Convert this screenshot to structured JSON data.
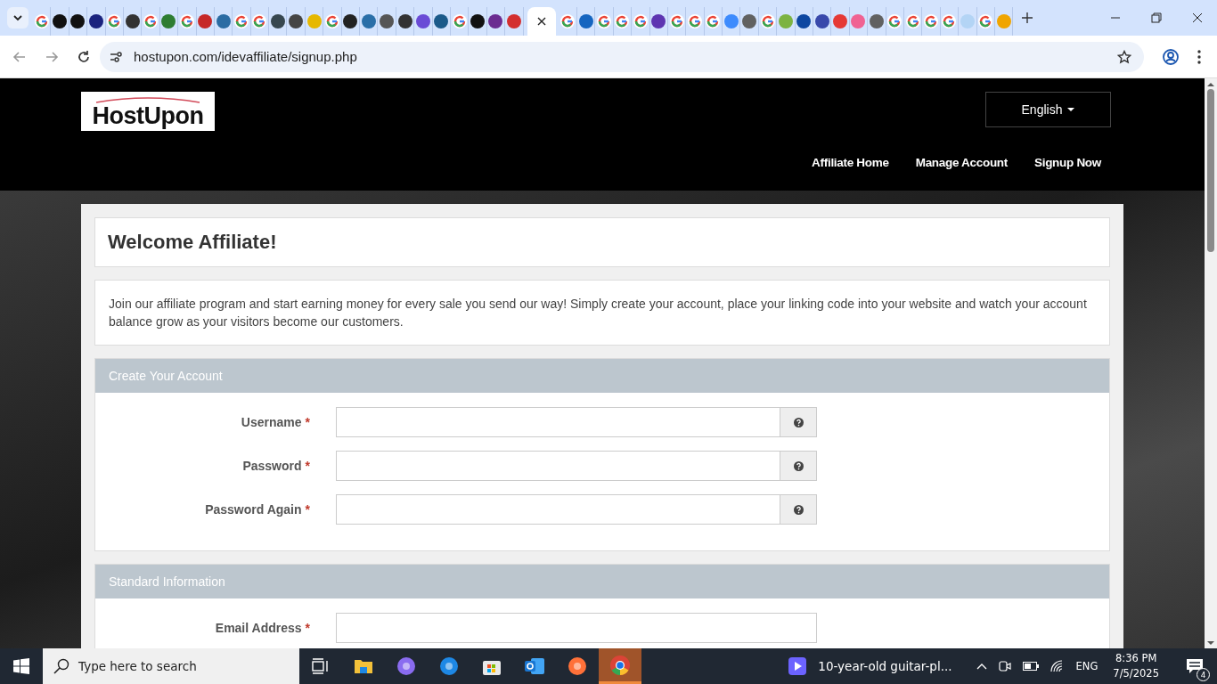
{
  "browser": {
    "tabs": [
      {
        "kind": "google",
        "selected": false
      },
      {
        "kind": "site",
        "color": "#111111",
        "selected": false
      },
      {
        "kind": "site",
        "color": "#111111",
        "selected": false
      },
      {
        "kind": "site",
        "color": "#1a237e",
        "selected": false
      },
      {
        "kind": "google",
        "selected": false
      },
      {
        "kind": "site",
        "color": "#333333",
        "selected": false
      },
      {
        "kind": "google",
        "selected": false
      },
      {
        "kind": "site",
        "color": "#2e7d32",
        "selected": false
      },
      {
        "kind": "google",
        "selected": false
      },
      {
        "kind": "site",
        "color": "#c62828",
        "selected": false
      },
      {
        "kind": "site",
        "color": "#2b6ca3",
        "selected": false
      },
      {
        "kind": "google",
        "selected": false
      },
      {
        "kind": "google",
        "selected": false
      },
      {
        "kind": "site",
        "color": "#37474f",
        "selected": false
      },
      {
        "kind": "site",
        "color": "#444444",
        "selected": false
      },
      {
        "kind": "site",
        "color": "#e6b800",
        "selected": false
      },
      {
        "kind": "google",
        "selected": false
      },
      {
        "kind": "site",
        "color": "#222222",
        "selected": false
      },
      {
        "kind": "site",
        "color": "#2a6fa8",
        "selected": false
      },
      {
        "kind": "site",
        "color": "#555555",
        "selected": false
      },
      {
        "kind": "site",
        "color": "#333333",
        "selected": false
      },
      {
        "kind": "site",
        "color": "#6a4bd6",
        "selected": false
      },
      {
        "kind": "site",
        "color": "#1b5a8a",
        "selected": false
      },
      {
        "kind": "google",
        "selected": false
      },
      {
        "kind": "site",
        "color": "#111111",
        "selected": false
      },
      {
        "kind": "site",
        "color": "#6b2c91",
        "selected": false
      },
      {
        "kind": "site",
        "color": "#d32f2f",
        "selected": false
      },
      {
        "kind": "blank",
        "selected": true
      },
      {
        "kind": "google",
        "selected": false
      },
      {
        "kind": "site",
        "color": "#1565c0",
        "selected": false
      },
      {
        "kind": "google",
        "selected": false
      },
      {
        "kind": "google",
        "selected": false
      },
      {
        "kind": "google",
        "selected": false
      },
      {
        "kind": "site",
        "color": "#5e35b1",
        "selected": false
      },
      {
        "kind": "google",
        "selected": false
      },
      {
        "kind": "google",
        "selected": false
      },
      {
        "kind": "google",
        "selected": false
      },
      {
        "kind": "site",
        "color": "#3d8bfd",
        "selected": false
      },
      {
        "kind": "site",
        "color": "#616161",
        "selected": false
      },
      {
        "kind": "google",
        "selected": false
      },
      {
        "kind": "site",
        "color": "#7cb342",
        "selected": false
      },
      {
        "kind": "site",
        "color": "#0d47a1",
        "selected": false
      },
      {
        "kind": "site",
        "color": "#3949ab",
        "selected": false
      },
      {
        "kind": "site",
        "color": "#e53935",
        "selected": false
      },
      {
        "kind": "site",
        "color": "#f06292",
        "selected": false
      },
      {
        "kind": "site",
        "color": "#616161",
        "selected": false
      },
      {
        "kind": "google",
        "selected": false
      },
      {
        "kind": "google",
        "selected": false
      },
      {
        "kind": "google",
        "selected": false
      },
      {
        "kind": "google",
        "selected": false
      },
      {
        "kind": "site",
        "color": "#b3d4f5",
        "selected": false
      },
      {
        "kind": "google",
        "selected": false
      },
      {
        "kind": "site",
        "color": "#f0a500",
        "selected": false
      }
    ],
    "address": "hostupon.com/idevaffiliate/signup.php"
  },
  "site": {
    "logo": "HostUpon",
    "language": "English",
    "nav": [
      {
        "label": "Affiliate Home"
      },
      {
        "label": "Manage Account"
      },
      {
        "label": "Signup Now"
      }
    ]
  },
  "welcome": {
    "title": "Welcome Affiliate!"
  },
  "intro": "Join our affiliate program and start earning money for every sale you send our way! Simply create your account, place your linking code into your website and watch your account balance grow as your visitors become our customers.",
  "sections": [
    {
      "title": "Create Your Account",
      "fields": [
        {
          "label": "Username",
          "required_mark": "*",
          "help": true
        },
        {
          "label": "Password",
          "required_mark": "*",
          "help": true
        },
        {
          "label": "Password Again",
          "required_mark": "*",
          "help": true
        }
      ]
    },
    {
      "title": "Standard Information",
      "fields": [
        {
          "label": "Email Address",
          "required_mark": "*",
          "help": false
        }
      ]
    }
  ],
  "taskbar": {
    "search_placeholder": "Type here to search",
    "apps": [
      {
        "kind": "task-view",
        "selected": false
      },
      {
        "kind": "folder",
        "selected": false
      },
      {
        "kind": "copilot",
        "selected": false
      },
      {
        "kind": "edge",
        "selected": false
      },
      {
        "kind": "store",
        "selected": false
      },
      {
        "kind": "outlook",
        "selected": false
      },
      {
        "kind": "firefox",
        "selected": false
      },
      {
        "kind": "chrome",
        "selected": true
      }
    ],
    "media": "10-year-old guitar-pl...",
    "language": "ENG",
    "time": "8:36 PM",
    "date": "7/5/2025",
    "notifications": "4"
  }
}
